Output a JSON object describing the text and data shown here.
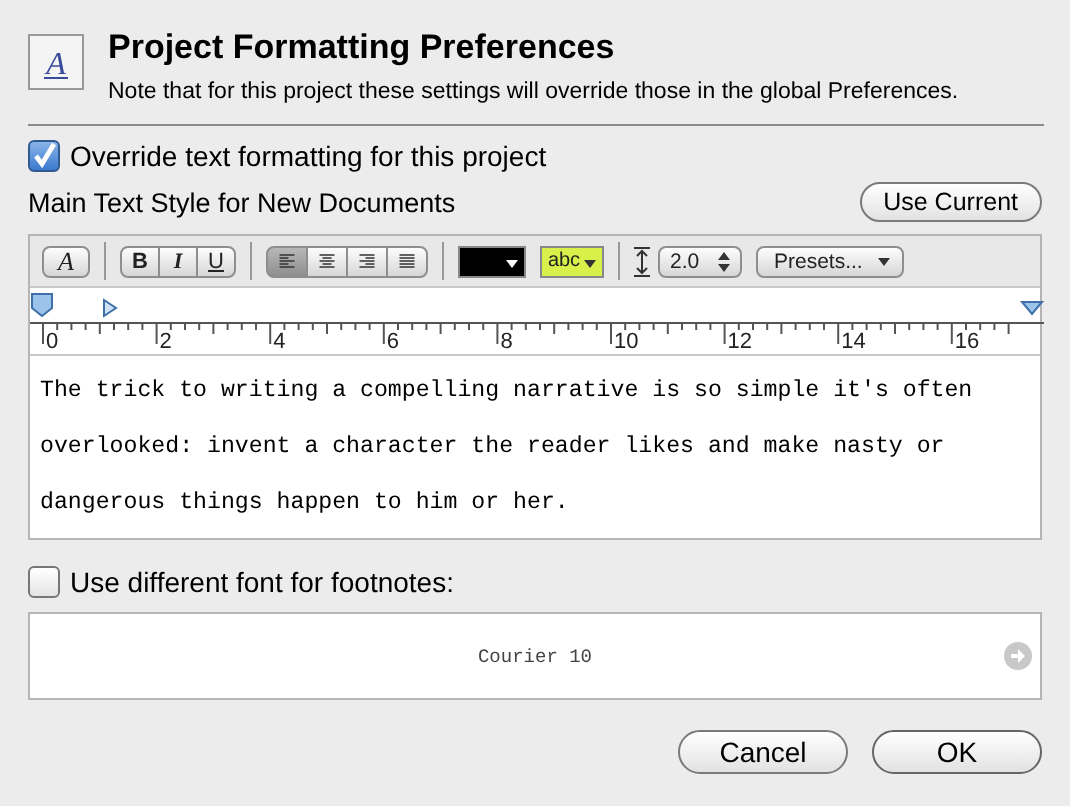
{
  "header": {
    "icon_letter": "A",
    "title": "Project Formatting Preferences",
    "note": "Note that for this project these settings will override those in the global Preferences."
  },
  "override": {
    "label": "Override text formatting for this project",
    "checked": true
  },
  "main_style": {
    "label": "Main Text Style for New Documents",
    "button": "Use Current"
  },
  "toolbar": {
    "style_button": "A",
    "format_buttons": [
      {
        "label": "B",
        "selected": false
      },
      {
        "label": "I",
        "selected": false
      },
      {
        "label": "U",
        "selected": false
      }
    ],
    "alignments": [
      {
        "kind": "left",
        "selected": true
      },
      {
        "kind": "center",
        "selected": false
      },
      {
        "kind": "right",
        "selected": false
      },
      {
        "kind": "justify",
        "selected": false
      }
    ],
    "highlight_label": "abc",
    "line_spacing": "2.0",
    "presets": "Presets..."
  },
  "ruler": {
    "labels": [
      "0",
      "2",
      "4",
      "6",
      "8",
      "10",
      "12",
      "14",
      "16"
    ]
  },
  "sample_text": "The trick to writing a compelling narrative is so simple it's often overlooked: invent a character the reader likes and make nasty or dangerous things happen to him or her.",
  "footnotes": {
    "label": "Use different font for footnotes:",
    "checked": false,
    "font": "Courier 10"
  },
  "buttons": [
    {
      "label": "Cancel",
      "kind": "normal"
    },
    {
      "label": "OK",
      "kind": "default"
    }
  ]
}
